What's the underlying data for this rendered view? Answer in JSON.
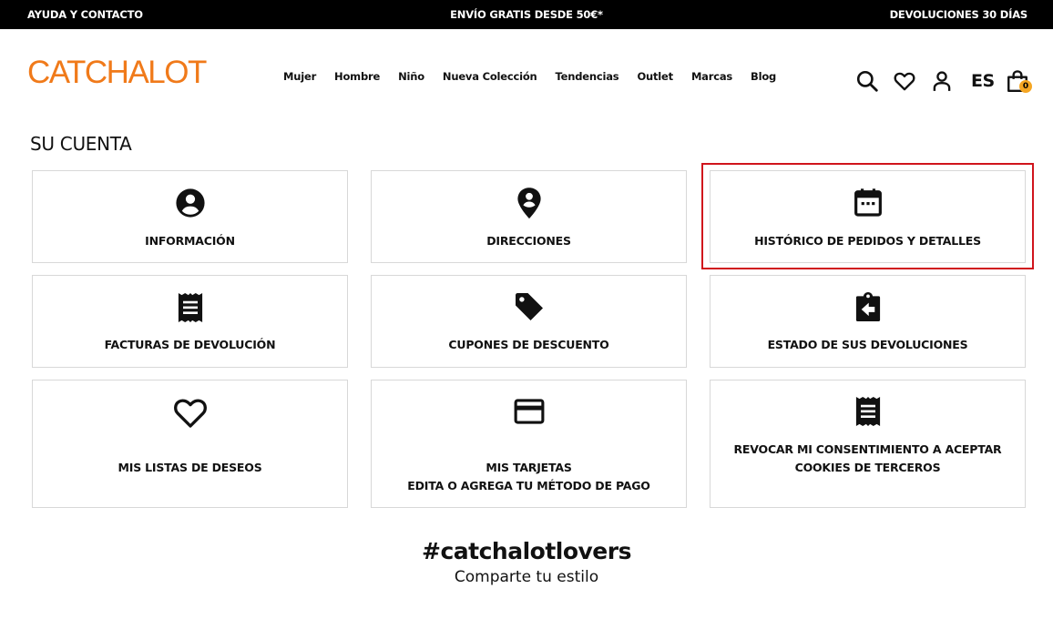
{
  "topbar": {
    "help": "AYUDA Y CONTACTO",
    "shipping": "ENVÍO GRATIS DESDE 50€*",
    "returns": "DEVOLUCIONES 30 DÍAS"
  },
  "header": {
    "logo": "CATCHALOT",
    "nav": [
      "Mujer",
      "Hombre",
      "Niño",
      "Nueva Colección",
      "Tendencias",
      "Outlet",
      "Marcas",
      "Blog"
    ],
    "lang": "ES",
    "cart_count": "0",
    "icons": [
      "search-icon",
      "heart-icon",
      "user-icon",
      "cart-icon"
    ]
  },
  "account": {
    "title": "SU CUENTA",
    "tiles": [
      {
        "label": "INFORMACIÓN",
        "icon": "user-circle-icon"
      },
      {
        "label": "DIRECCIONES",
        "icon": "location-pin-icon"
      },
      {
        "label": "HISTÓRICO DE PEDIDOS Y DETALLES",
        "icon": "calendar-icon"
      },
      {
        "label": "FACTURAS DE DEVOLUCIÓN",
        "icon": "receipt-icon"
      },
      {
        "label": "CUPONES DE DESCUENTO",
        "icon": "tag-icon"
      },
      {
        "label": "ESTADO DE SUS DEVOLUCIONES",
        "icon": "clipboard-return-icon"
      },
      {
        "label": "MIS LISTAS DE DESEOS",
        "icon": "heart-outline-icon"
      },
      {
        "label_line1": "MIS TARJETAS",
        "label_line2": "EDITA O AGREGA TU MÉTODO DE PAGO",
        "icon": "credit-card-icon"
      },
      {
        "label_line1": "REVOCAR MI CONSENTIMIENTO A ACEPTAR",
        "label_line2": "COOKIES DE TERCEROS",
        "icon": "receipt-icon"
      }
    ]
  },
  "footer": {
    "hashtag": "#catchalotlovers",
    "subtitle": "Comparte tu estilo"
  },
  "colors": {
    "brand": "#f07a1a",
    "highlight": "#d0141c",
    "badge": "#f5a623"
  }
}
